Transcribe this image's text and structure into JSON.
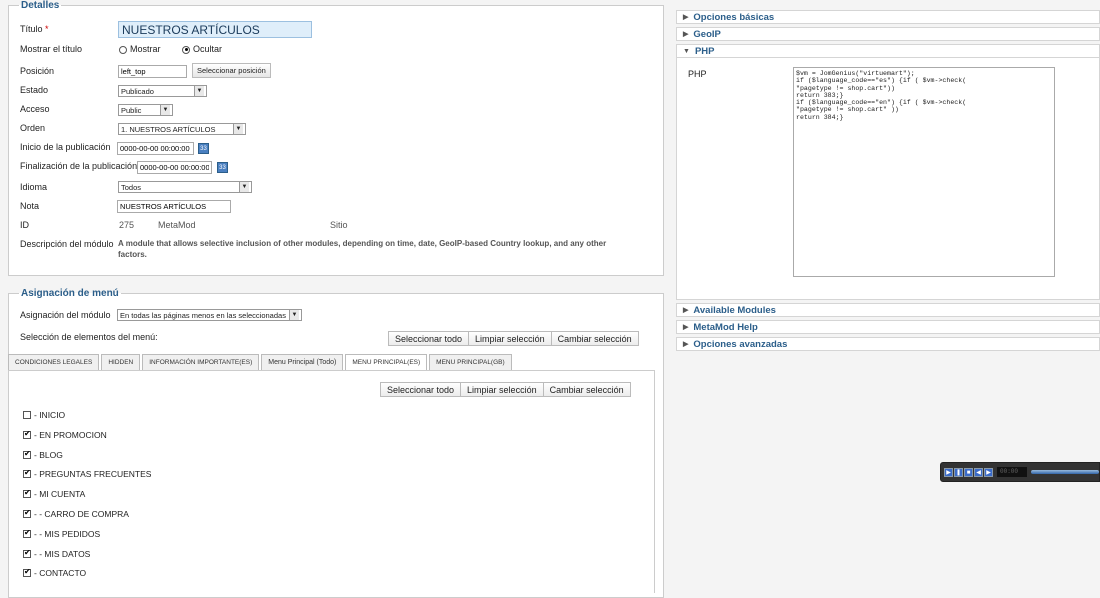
{
  "detalles": {
    "legend": "Detalles",
    "titulo_label": "Título",
    "required_mark": "*",
    "titulo_value": "NUESTROS ARTÍCULOS",
    "mostrar_label": "Mostrar el título",
    "mostrar_option": "Mostrar",
    "ocultar_option": "Ocultar",
    "posicion_label": "Posición",
    "posicion_value": "left_top",
    "posicion_button": "Seleccionar posición",
    "estado_label": "Estado",
    "estado_value": "Publicado",
    "acceso_label": "Acceso",
    "acceso_value": "Public",
    "orden_label": "Orden",
    "orden_value": "1. NUESTROS ARTÍCULOS",
    "inicio_label": "Inicio de la publicación",
    "inicio_value": "0000-00-00 00:00:00",
    "fin_label": "Finalización de la publicación",
    "fin_value": "0000-00-00 00:00:00",
    "calendar_text": "33",
    "idioma_label": "Idioma",
    "idioma_value": "Todos",
    "nota_label": "Nota",
    "nota_value": "NUESTROS ARTÍCULOS",
    "id_label": "ID",
    "id_value": "275",
    "metamod_label": "MetaMod",
    "sitio_label": "Sitio",
    "descripcion_label": "Descripción del módulo",
    "descripcion_line1": "A module that allows selective inclusion of other modules, depending on time, date, GeoIP-based Country lookup, and any other",
    "descripcion_line2": "factors."
  },
  "menu": {
    "legend": "Asignación de menú",
    "asignacion_label": "Asignación del módulo",
    "asignacion_value": "En todas las páginas menos en las seleccionadas",
    "seleccion_label": "Selección de elementos del menú:",
    "buttons": [
      "Seleccionar todo",
      "Limpiar selección",
      "Cambiar selección"
    ],
    "tabs": [
      "CONDICIONES LEGALES",
      "HIDDEN",
      "INFORMACIÓN IMPORTANTE(ES)",
      "Menu Principal (Todo)",
      "MENU PRINCIPAL(ES)",
      "MENU PRINCIPAL(GB)"
    ],
    "items": [
      {
        "label": "- INICIO",
        "checked": false
      },
      {
        "label": "- EN PROMOCION",
        "checked": true
      },
      {
        "label": "- BLOG",
        "checked": true
      },
      {
        "label": "- PREGUNTAS FRECUENTES",
        "checked": true
      },
      {
        "label": "- MI CUENTA",
        "checked": true
      },
      {
        "label": "- - CARRO DE COMPRA",
        "checked": true
      },
      {
        "label": "- - MIS PEDIDOS",
        "checked": true
      },
      {
        "label": "- - MIS DATOS",
        "checked": true
      },
      {
        "label": "- CONTACTO",
        "checked": true
      }
    ]
  },
  "right": {
    "panels_top": [
      "Opciones básicas",
      "GeoIP",
      "PHP"
    ],
    "php_label": "PHP",
    "php_code": "$vm = JomGenius(\"virtuemart\");\nif ($language_code==\"es\") {if ( $vm->check(\n\"pagetype != shop.cart\"))\nreturn 383;}\nif ($language_code==\"en\") {if ( $vm->check(\n\"pagetype != shop.cart\" ))\nreturn 384;}",
    "panels_bottom": [
      "Available Modules",
      "MetaMod Help",
      "Opciones avanzadas"
    ]
  },
  "player": {
    "time": "00:00"
  },
  "colors": {
    "accent": "#2b5e8a",
    "title_field_bg": "#dfeefa",
    "calendar_blue": "#4a7fc0"
  }
}
